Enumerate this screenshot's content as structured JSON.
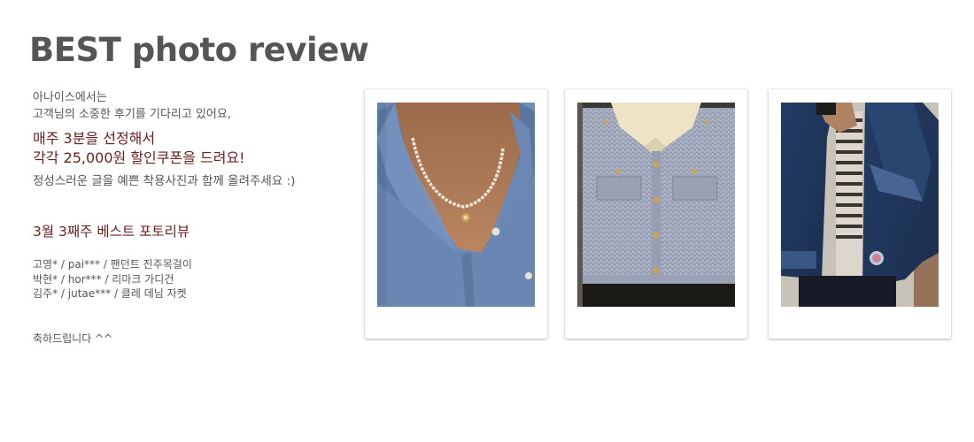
{
  "header": {
    "title": "BEST photo review"
  },
  "intro": {
    "line1": "아나이스에서는",
    "line2": "고객님의 소중한 후기를 기다리고 있어요,"
  },
  "highlight": {
    "line1": "매주 3분을 선정해서",
    "line2": "각각 25,000원 할인쿠폰을 드려요!"
  },
  "sub": "정성스러운 글을 예쁜 착용사진과 함께 올려주세요 :)",
  "week_title": "3월 3째주 베스트 포토리뷰",
  "winners": [
    "고영* / pai*** / 팬던트 진주목걸이",
    "박현* / hor*** / 리마크 가디건",
    "김주* / jutae*** / 클레 데님 자켓"
  ],
  "congrats": "축하드립니다 ^^",
  "photos": [
    {
      "subject": "pearl pendant necklace on denim shirt"
    },
    {
      "subject": "blue knit cardigan with collar"
    },
    {
      "subject": "denim jacket"
    }
  ]
}
